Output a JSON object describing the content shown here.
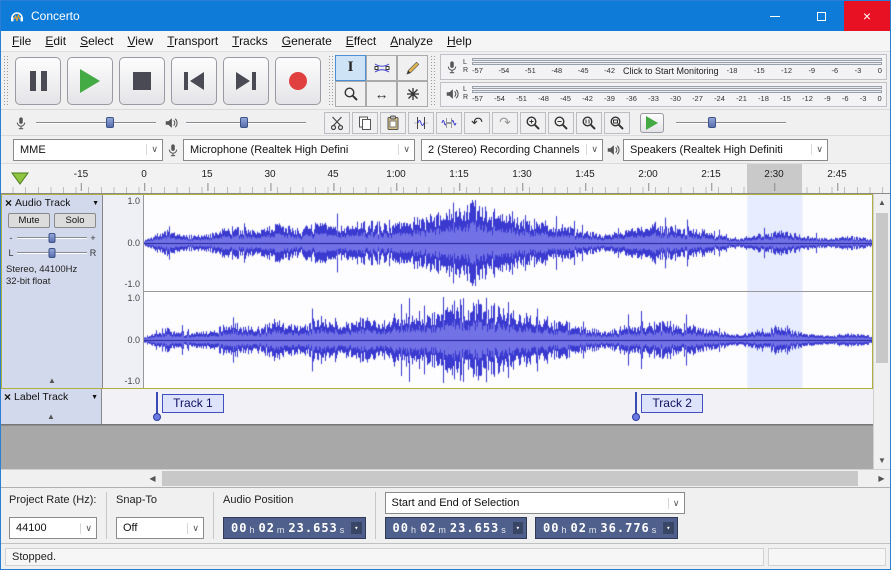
{
  "colors": {
    "titlebar": "#0d7bd7",
    "close_red": "#e81123",
    "waveform": "#3a3ad0",
    "waveform_rms": "#7272e6",
    "track_panel": "#d2d9ec",
    "selection_highlight": "#e7edff",
    "timeline_selection": "#c9c9c9",
    "timebox": "#4f608c",
    "record_red": "#e04040",
    "play_green": "#44aa44"
  },
  "titlebar": {
    "title": "Concerto",
    "close_icon": "×"
  },
  "menu": {
    "items": [
      "File",
      "Edit",
      "Select",
      "View",
      "Transport",
      "Tracks",
      "Generate",
      "Effect",
      "Analyze",
      "Help"
    ]
  },
  "icons": {
    "close": "×",
    "dropdown": "▾",
    "combo_arrow": "∨",
    "track_menu_arrow": "▼",
    "collapse_arrow": "▲",
    "undo": "↶",
    "redo": "↷",
    "time_shift": "↔",
    "selection_tool": "I",
    "scroll_left": "◀",
    "scroll_right": "▶",
    "scroll_up": "▲",
    "scroll_down": "▼",
    "minus": "-",
    "plus": "+",
    "pan_left": "L",
    "pan_right": "R"
  },
  "meters": {
    "record": {
      "l": "L",
      "r": "R",
      "scale_left": [
        "-57",
        "-54",
        "-51",
        "-48",
        "-45",
        "-42"
      ],
      "monitor_text": "Click to Start Monitoring",
      "scale_right": [
        "-18",
        "-15",
        "-12",
        "-9",
        "-6",
        "-3",
        "0"
      ]
    },
    "playback": {
      "l": "L",
      "r": "R",
      "scale": [
        "-57",
        "-54",
        "-51",
        "-48",
        "-45",
        "-42",
        "-39",
        "-36",
        "-33",
        "-30",
        "-27",
        "-24",
        "-21",
        "-18",
        "-15",
        "-12",
        "-9",
        "-6",
        "-3",
        "0"
      ]
    }
  },
  "sliders": {
    "recording_volume_pct": 62,
    "playback_volume_pct": 48,
    "play_speed_pct": 33,
    "gain_pct": 50,
    "pan_pct": 50
  },
  "devices": {
    "host": "MME",
    "input": "Microphone (Realtek High Defini",
    "channels": "2 (Stereo) Recording Channels",
    "output": "Speakers (Realtek High Definiti"
  },
  "timeline": {
    "ticks": [
      "-15",
      "0",
      "15",
      "30",
      "45",
      "1:00",
      "1:15",
      "1:30",
      "1:45",
      "2:00",
      "2:15",
      "2:30",
      "2:45"
    ]
  },
  "selection": {
    "start_s": 143.653,
    "end_s": 156.776
  },
  "audio_track": {
    "name": "Audio Track",
    "mute": "Mute",
    "solo": "Solo",
    "info_line1": "Stereo, 44100Hz",
    "info_line2": "32-bit float",
    "scale": [
      "1.0",
      "0.0",
      "-1.0"
    ]
  },
  "waveform": {
    "envelope": [
      0.08,
      0.3,
      0.18,
      0.22,
      0.42,
      0.3,
      0.5,
      0.36,
      0.54,
      0.4,
      0.52,
      0.46,
      0.6,
      0.66,
      0.88,
      0.97,
      0.8,
      0.68,
      0.55,
      0.42,
      0.3,
      0.22,
      0.36,
      0.48,
      0.42,
      0.36,
      0.22,
      0.12,
      0.26,
      0.3,
      0.16,
      0.12,
      0.18,
      0.1
    ]
  },
  "label_track": {
    "name": "Label Track",
    "labels": [
      {
        "text": "Track 1",
        "time_s": 2.9
      },
      {
        "text": "Track 2",
        "time_s": 117.0
      }
    ]
  },
  "selection_toolbar": {
    "project_rate_label": "Project Rate (Hz):",
    "project_rate": "44100",
    "snap_label": "Snap-To",
    "snap_value": "Off",
    "audio_position_label": "Audio Position",
    "sel_mode": "Start and End of Selection"
  },
  "time_displays": {
    "unit_h": "h",
    "unit_m": "m",
    "unit_s": "s",
    "audio_position": {
      "h": "00",
      "m": "02",
      "s": "23.653"
    },
    "sel_start": {
      "h": "00",
      "m": "02",
      "s": "23.653"
    },
    "sel_end": {
      "h": "00",
      "m": "02",
      "s": "36.776"
    }
  },
  "status": {
    "text": "Stopped."
  }
}
